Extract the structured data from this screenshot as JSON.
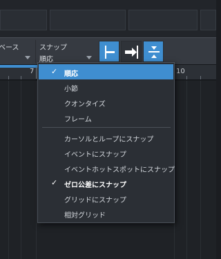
{
  "toolbar": {
    "base_label": "ベース",
    "snap_label": "スナップ",
    "snap_value": "順応",
    "snap_buttons": [
      {
        "name": "snap-to-start-icon",
        "active": true
      },
      {
        "name": "snap-to-end-icon",
        "active": false
      },
      {
        "name": "snap-to-both-icon",
        "active": true
      }
    ]
  },
  "ruler": {
    "marks": [
      "7",
      "10"
    ]
  },
  "menu": {
    "items": [
      {
        "label": "順応",
        "checked": true,
        "selected": true
      },
      {
        "label": "小節"
      },
      {
        "label": "クオンタイズ"
      },
      {
        "label": "フレーム"
      },
      {
        "label": "カーソルとループにスナップ"
      },
      {
        "label": "イベントにスナップ"
      },
      {
        "label": "イベントホットスポットにスナップ"
      },
      {
        "label": "ゼロ公差にスナップ",
        "checked": true,
        "bold": true
      },
      {
        "label": "グリッドにスナップ"
      },
      {
        "label": "相対グリッド"
      }
    ],
    "check_glyph": "✓"
  },
  "colors": {
    "accent": "#3f8ed0",
    "menu_bg": "#2b2f35",
    "toolbar_bg": "#363a41"
  }
}
